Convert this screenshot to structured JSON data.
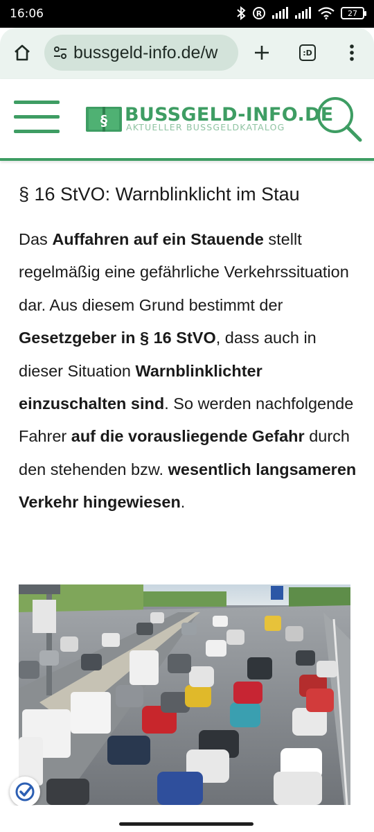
{
  "status_bar": {
    "time": "16:06",
    "battery": "27",
    "icons": [
      "bluetooth-icon",
      "registered-icon",
      "signal-icon",
      "signal-icon",
      "wifi-icon",
      "battery-icon"
    ]
  },
  "browser": {
    "url": "bussgeld-info.de/w",
    "tab_count": ":D",
    "icons": [
      "home-icon",
      "site-settings-icon",
      "new-tab-icon",
      "tab-switcher-icon",
      "more-icon"
    ]
  },
  "site": {
    "logo_title": "BUSSGELD-INFO.DE",
    "logo_subtitle": "AKTUELLER BUSSGELDKATALOG",
    "logo_symbol": "§",
    "accent_color": "#3e9d63"
  },
  "article": {
    "title": "§ 16 StVO: Warnblinklicht im Stau",
    "paragraph": [
      {
        "text": "Das ",
        "bold": false
      },
      {
        "text": "Auffahren auf ein Stauende",
        "bold": true
      },
      {
        "text": " stellt regelmäßig eine gefährliche Verkehrssituation dar. Aus diesem Grund bestimmt der ",
        "bold": false
      },
      {
        "text": "Gesetzgeber in § 16 StVO",
        "bold": true
      },
      {
        "text": ", dass auch in dieser Situation ",
        "bold": false
      },
      {
        "text": "Warnblinklichter einzuschalten sind",
        "bold": true
      },
      {
        "text": ". So werden nachfolgende Fahrer ",
        "bold": false
      },
      {
        "text": "auf die vorausliegende Gefahr",
        "bold": true
      },
      {
        "text": " durch den stehenden bzw. ",
        "bold": false
      },
      {
        "text": "wesentlich langsameren Verkehr hingewiesen",
        "bold": true
      },
      {
        "text": ".",
        "bold": false
      }
    ]
  }
}
